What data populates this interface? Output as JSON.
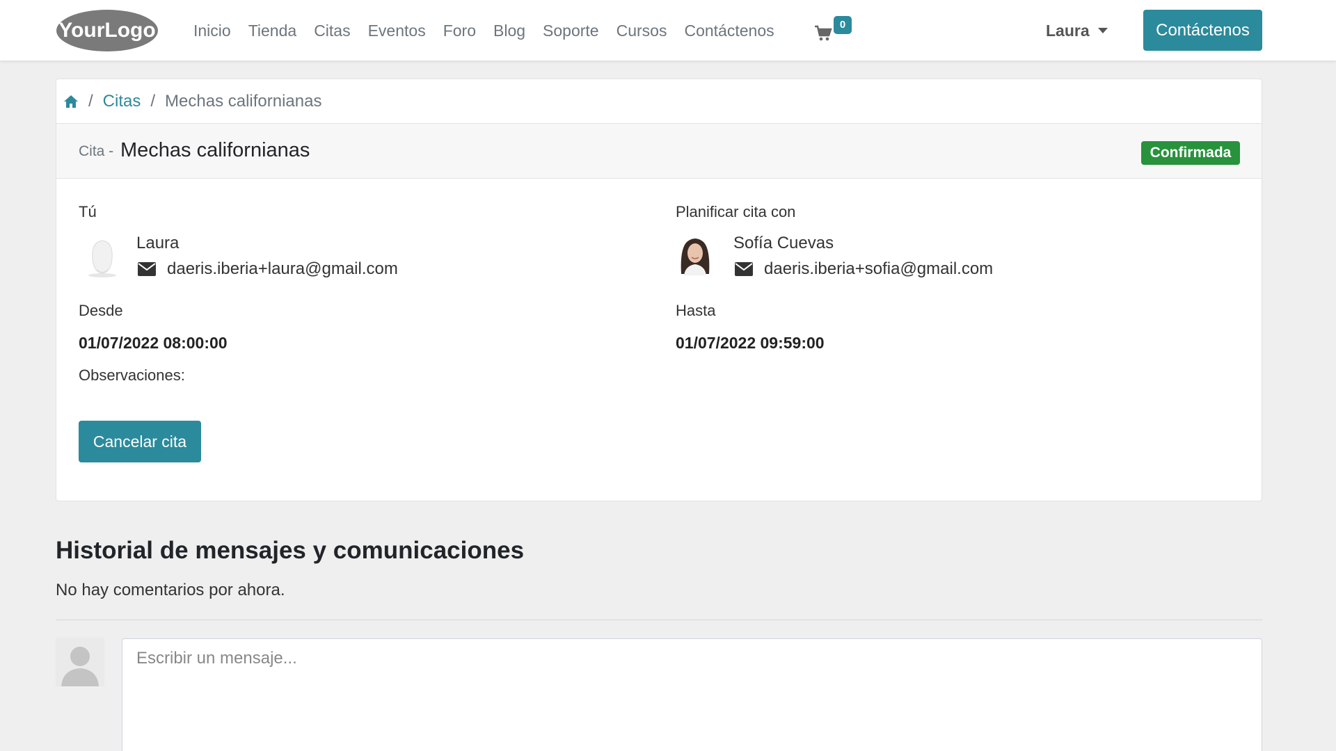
{
  "header": {
    "logo_text": "YourLogo",
    "nav": [
      "Inicio",
      "Tienda",
      "Citas",
      "Eventos",
      "Foro",
      "Blog",
      "Soporte",
      "Cursos",
      "Contáctenos"
    ],
    "cart_count": "0",
    "user_name": "Laura",
    "cta_label": "Contáctenos"
  },
  "breadcrumb": {
    "section": "Citas",
    "current": "Mechas californianas"
  },
  "appointment": {
    "prefix": "Cita -",
    "title": "Mechas californianas",
    "status": "Confirmada",
    "you_label": "Tú",
    "you_name": "Laura",
    "you_email": "daeris.iberia+laura@gmail.com",
    "with_label": "Planificar cita con",
    "with_name": "Sofía Cuevas",
    "with_email": "daeris.iberia+sofia@gmail.com",
    "from_label": "Desde",
    "from_value": "01/07/2022 08:00:00",
    "to_label": "Hasta",
    "to_value": "01/07/2022 09:59:00",
    "notes_label": "Observaciones:",
    "cancel_label": "Cancelar cita"
  },
  "history": {
    "title": "Historial de mensajes y comunicaciones",
    "empty_text": "No hay comentarios por ahora.",
    "message_placeholder": "Escribir un mensaje..."
  },
  "colors": {
    "accent": "#2b8a9c",
    "status_green": "#28923d"
  },
  "icons": [
    "home-icon",
    "cart-icon",
    "envelope-icon",
    "user-avatar-icon"
  ]
}
